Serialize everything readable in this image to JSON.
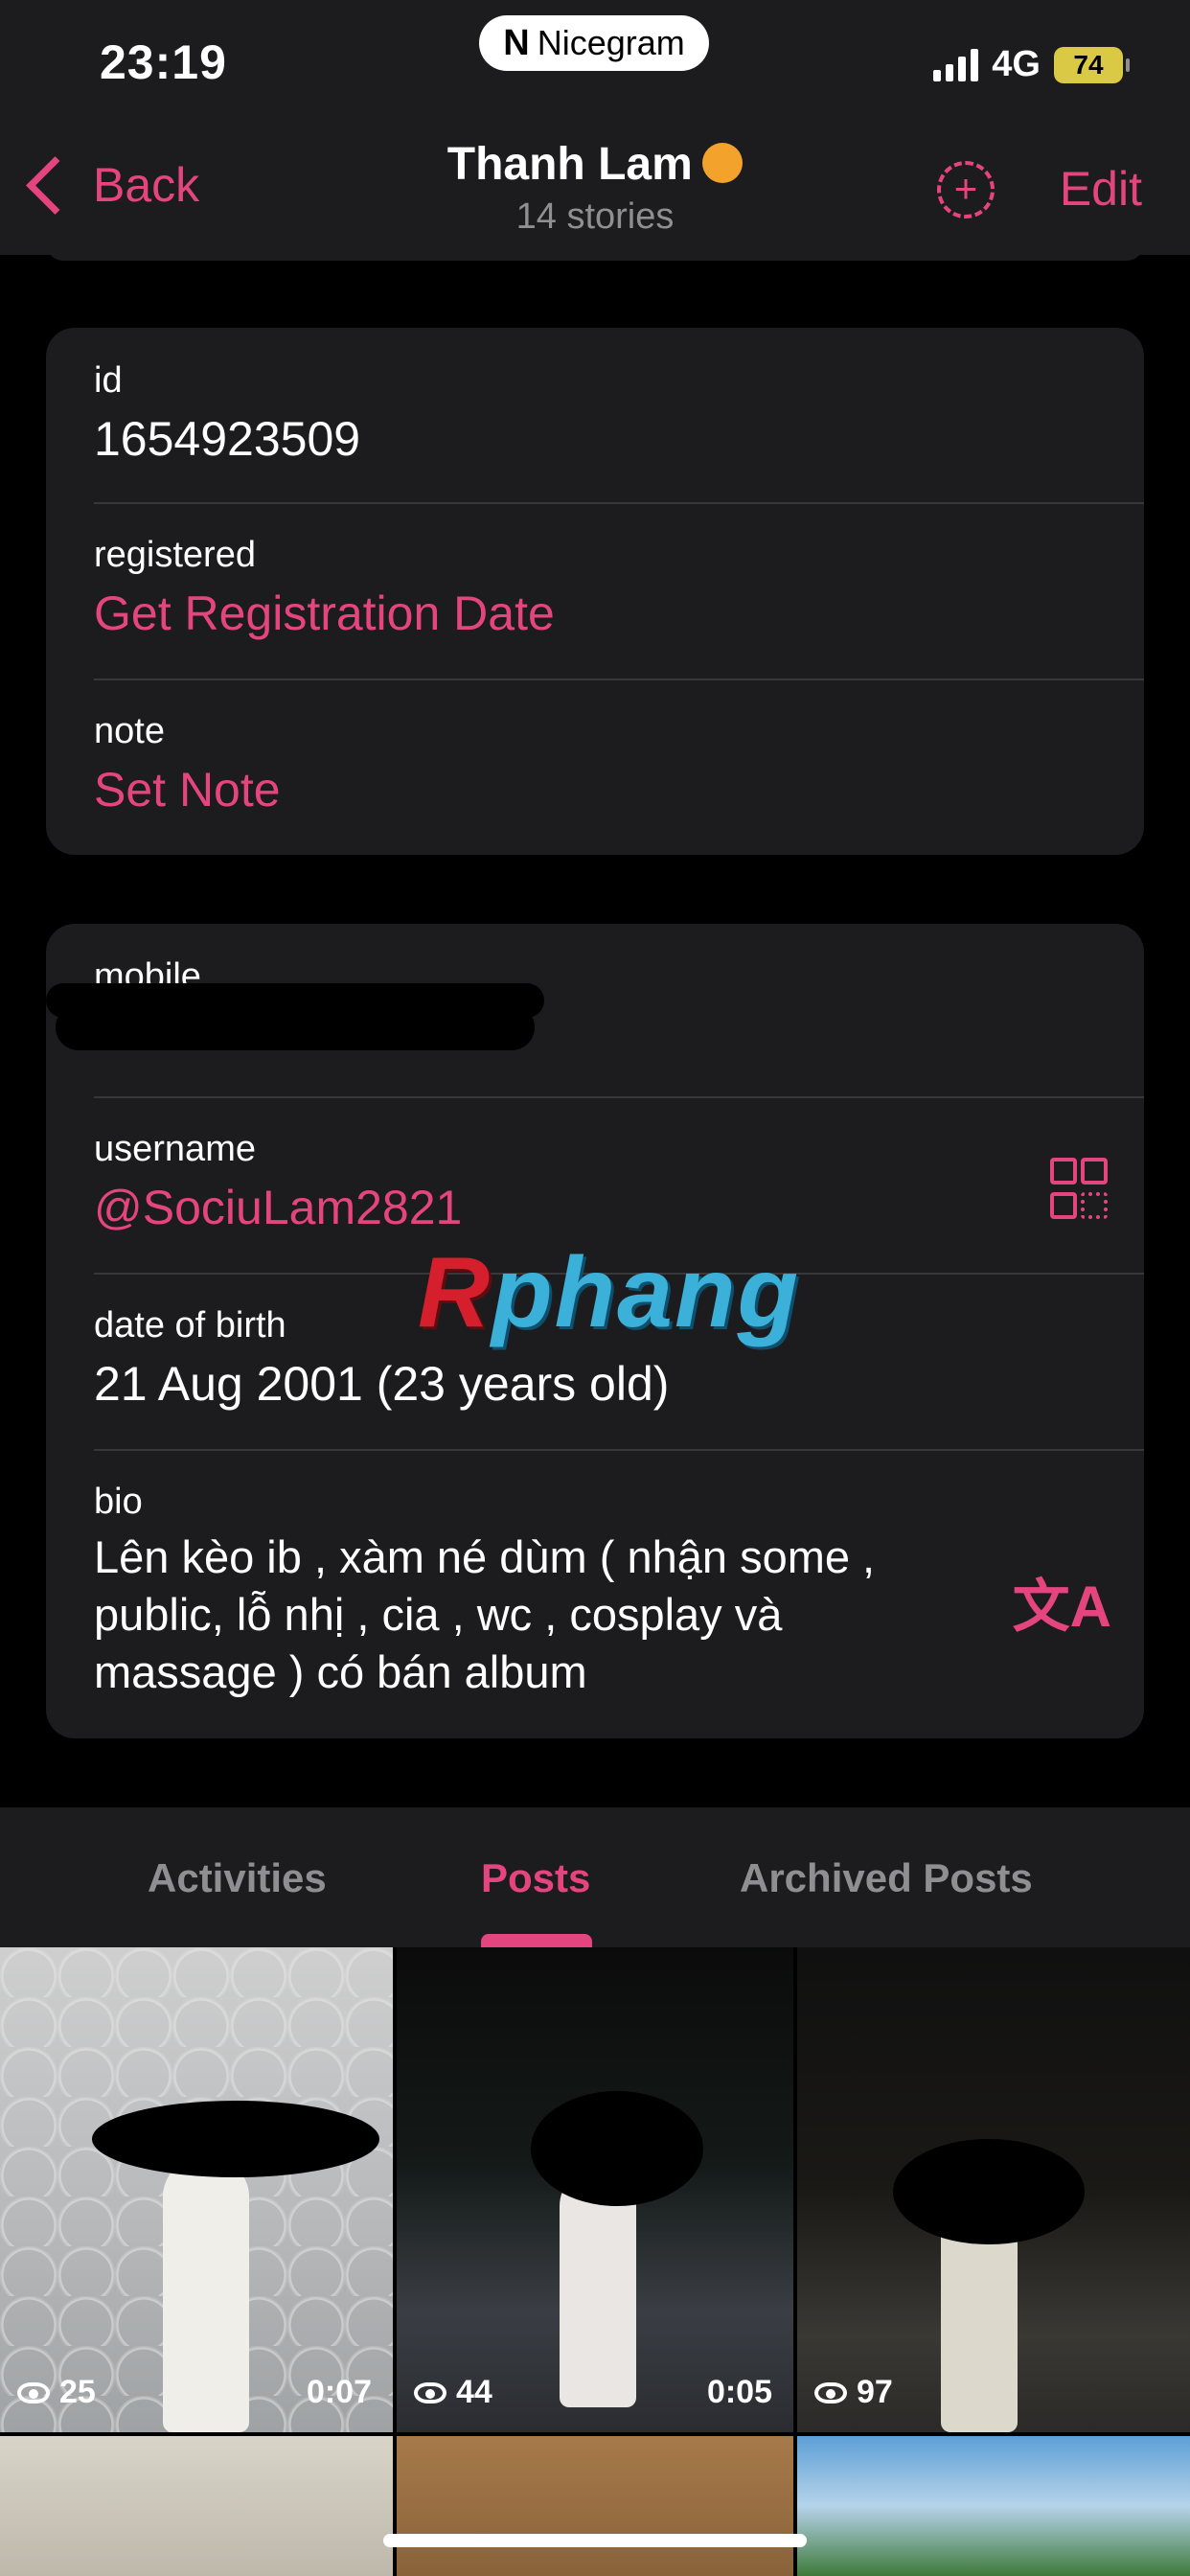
{
  "status_bar": {
    "time": "23:19",
    "app_pill": "Nicegram",
    "network": "4G",
    "battery": "74"
  },
  "nav": {
    "back_label": "Back",
    "title": "Thanh Lam",
    "subtitle": "14 stories",
    "edit_label": "Edit",
    "add_story_icon": "plus-circle-dashed-icon"
  },
  "info_card": {
    "id_label": "id",
    "id_value": "1654923509",
    "registered_label": "registered",
    "registered_value": "Get Registration Date",
    "note_label": "note",
    "note_value": "Set Note"
  },
  "profile_card": {
    "mobile_label": "mobile",
    "username_label": "username",
    "username_value": "@SociuLam2821",
    "dob_label": "date of birth",
    "dob_value": "21 Aug 2001 (23 years old)",
    "bio_label": "bio",
    "bio_lines": [
      "Lên kèo ib , xàm né dùm ( nhận some ,",
      "public, lỗ nhị , cia , wc , cosplay và",
      "massage ) có bán album"
    ]
  },
  "watermark": {
    "first": "R",
    "rest": "phang"
  },
  "tabs": {
    "activities": "Activities",
    "posts": "Posts",
    "archived": "Archived Posts"
  },
  "posts": [
    {
      "views": "25",
      "duration": "0:07"
    },
    {
      "views": "44",
      "duration": "0:05"
    },
    {
      "views": "97",
      "duration": ""
    }
  ],
  "colors": {
    "accent": "#e5457f",
    "surface": "#1c1c1e",
    "background": "#000000"
  }
}
